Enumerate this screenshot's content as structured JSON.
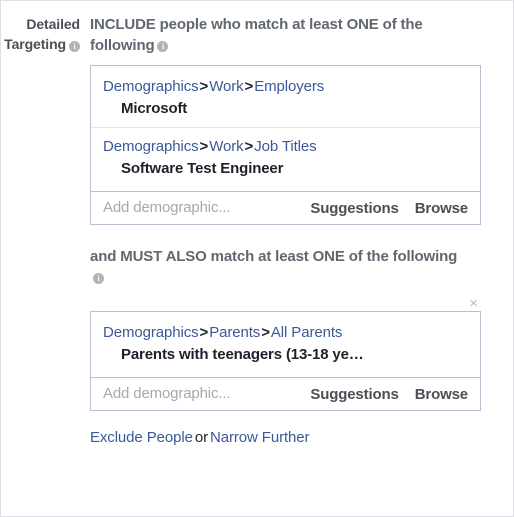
{
  "field": {
    "label_line1": "Detailed",
    "label_line2": "Targeting",
    "label_info_icon": "info-icon"
  },
  "include_section": {
    "heading": "INCLUDE people who match at least ONE of the following",
    "info_icon": "info-icon",
    "entries": [
      {
        "crumb1": "Demographics",
        "sep1": ">",
        "crumb2": "Work",
        "sep2": ">",
        "crumb3": "Employers",
        "item": "Microsoft"
      },
      {
        "crumb1": "Demographics",
        "sep1": ">",
        "crumb2": "Work",
        "sep2": ">",
        "crumb3": "Job Titles",
        "item": "Software Test Engineer"
      }
    ],
    "input_placeholder": "Add demographic...",
    "input_value": "",
    "suggestions_label": "Suggestions",
    "browse_label": "Browse"
  },
  "narrow_section": {
    "heading": "and MUST ALSO match at least ONE of the following",
    "info_icon": "info-icon",
    "close_icon": "×",
    "entries": [
      {
        "crumb1": "Demographics",
        "sep1": ">",
        "crumb2": "Parents",
        "sep2": ">",
        "crumb3": "All Parents",
        "item": "Parents with teenagers (13-18 ye…"
      }
    ],
    "input_placeholder": "Add demographic...",
    "input_value": "",
    "suggestions_label": "Suggestions",
    "browse_label": "Browse"
  },
  "footer": {
    "exclude_label": "Exclude People",
    "or_label": "or",
    "narrow_label": "Narrow Further"
  },
  "colors": {
    "link_blue": "#3b5998",
    "heading_gray": "#606770",
    "box_border": "#b7c0d1",
    "placeholder_gray": "#a5a8ad",
    "text_dark": "#1d2129"
  }
}
